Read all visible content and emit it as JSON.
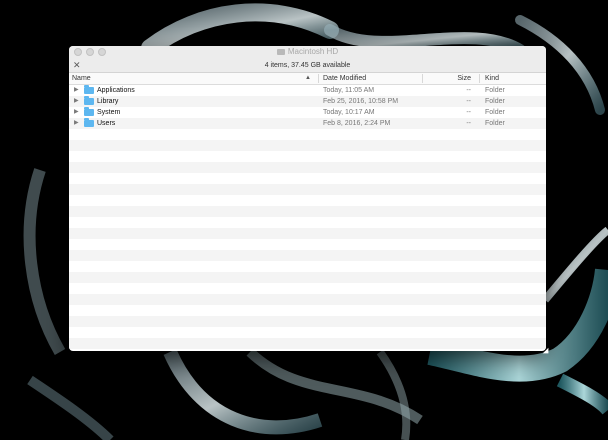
{
  "window": {
    "title": "Macintosh HD",
    "status": "4 items, 37.45 GB available"
  },
  "columns": {
    "name": "Name",
    "date": "Date Modified",
    "size": "Size",
    "kind": "Kind"
  },
  "rows": [
    {
      "name": "Applications",
      "date": "Today, 11:05 AM",
      "size": "--",
      "kind": "Folder"
    },
    {
      "name": "Library",
      "date": "Feb 25, 2016, 10:58 PM",
      "size": "--",
      "kind": "Folder"
    },
    {
      "name": "System",
      "date": "Today, 10:17 AM",
      "size": "--",
      "kind": "Folder"
    },
    {
      "name": "Users",
      "date": "Feb 8, 2016, 2:24 PM",
      "size": "--",
      "kind": "Folder"
    }
  ],
  "colors": {
    "folder": "#5db7f0",
    "desktop": "#000000",
    "stripe": "#f4f4f4"
  }
}
